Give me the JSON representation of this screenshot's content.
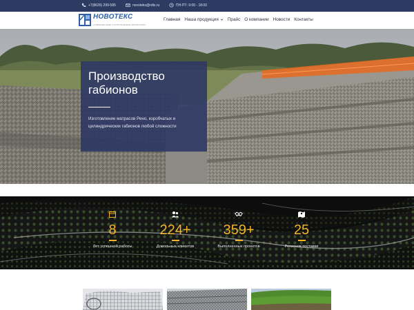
{
  "topbar": {
    "phone": "+7(8635) 299-585",
    "email": "novoteks@rdtx.ru",
    "hours": "ПН-ПТ: 9:00 - 18:00"
  },
  "header": {
    "logo_name": "НОВОТЕКС",
    "logo_sub": "СОВРЕМЕННЫЕ СТРОИТЕЛЬНЫЕ МАТЕРИАЛЫ"
  },
  "nav": {
    "items": [
      "Главная",
      "Наша продукция",
      "Прайс",
      "О компании",
      "Новости",
      "Контакты"
    ]
  },
  "hero": {
    "title": "Производство габионов",
    "description": "Изготовление матрасов Рено, коробчатых и цилиндрических габионов любой сложности"
  },
  "stats": [
    {
      "icon": "calendar-icon",
      "value": "8",
      "label": "Лет успешной работы"
    },
    {
      "icon": "users-icon",
      "value": "224+",
      "label": "Довольных клиентов"
    },
    {
      "icon": "handshake-icon",
      "value": "359+",
      "label": "Выполненных проектов"
    },
    {
      "icon": "map-icon",
      "value": "25",
      "label": "Регионов поставки"
    }
  ],
  "colors": {
    "topbar": "#2d3b62",
    "accent": "#f3b42a",
    "hero_card": "#2d3764",
    "logo_blue": "#2f5fa8"
  }
}
